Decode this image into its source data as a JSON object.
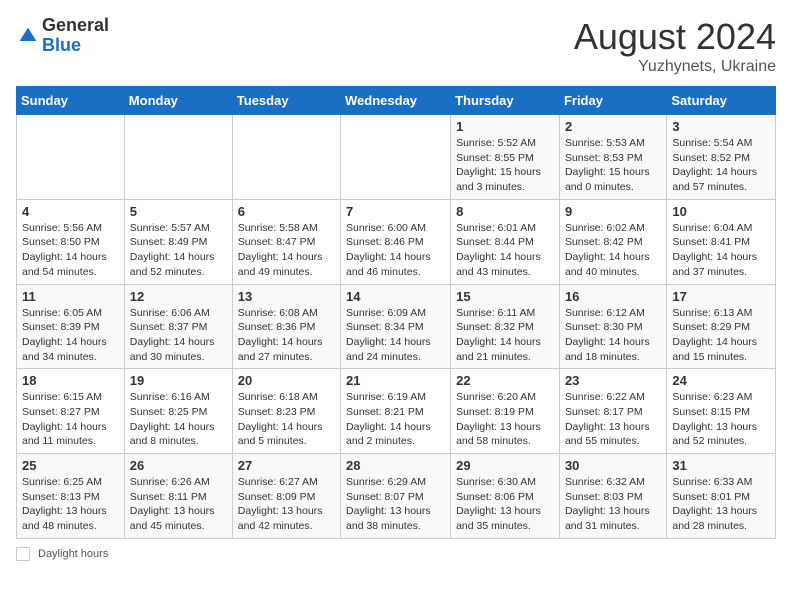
{
  "logo": {
    "general": "General",
    "blue": "Blue"
  },
  "title": "August 2024",
  "location": "Yuzhynets, Ukraine",
  "days_of_week": [
    "Sunday",
    "Monday",
    "Tuesday",
    "Wednesday",
    "Thursday",
    "Friday",
    "Saturday"
  ],
  "footer_label": "Daylight hours",
  "weeks": [
    [
      {
        "day": "",
        "info": ""
      },
      {
        "day": "",
        "info": ""
      },
      {
        "day": "",
        "info": ""
      },
      {
        "day": "",
        "info": ""
      },
      {
        "day": "1",
        "info": "Sunrise: 5:52 AM\nSunset: 8:55 PM\nDaylight: 15 hours\nand 3 minutes."
      },
      {
        "day": "2",
        "info": "Sunrise: 5:53 AM\nSunset: 8:53 PM\nDaylight: 15 hours\nand 0 minutes."
      },
      {
        "day": "3",
        "info": "Sunrise: 5:54 AM\nSunset: 8:52 PM\nDaylight: 14 hours\nand 57 minutes."
      }
    ],
    [
      {
        "day": "4",
        "info": "Sunrise: 5:56 AM\nSunset: 8:50 PM\nDaylight: 14 hours\nand 54 minutes."
      },
      {
        "day": "5",
        "info": "Sunrise: 5:57 AM\nSunset: 8:49 PM\nDaylight: 14 hours\nand 52 minutes."
      },
      {
        "day": "6",
        "info": "Sunrise: 5:58 AM\nSunset: 8:47 PM\nDaylight: 14 hours\nand 49 minutes."
      },
      {
        "day": "7",
        "info": "Sunrise: 6:00 AM\nSunset: 8:46 PM\nDaylight: 14 hours\nand 46 minutes."
      },
      {
        "day": "8",
        "info": "Sunrise: 6:01 AM\nSunset: 8:44 PM\nDaylight: 14 hours\nand 43 minutes."
      },
      {
        "day": "9",
        "info": "Sunrise: 6:02 AM\nSunset: 8:42 PM\nDaylight: 14 hours\nand 40 minutes."
      },
      {
        "day": "10",
        "info": "Sunrise: 6:04 AM\nSunset: 8:41 PM\nDaylight: 14 hours\nand 37 minutes."
      }
    ],
    [
      {
        "day": "11",
        "info": "Sunrise: 6:05 AM\nSunset: 8:39 PM\nDaylight: 14 hours\nand 34 minutes."
      },
      {
        "day": "12",
        "info": "Sunrise: 6:06 AM\nSunset: 8:37 PM\nDaylight: 14 hours\nand 30 minutes."
      },
      {
        "day": "13",
        "info": "Sunrise: 6:08 AM\nSunset: 8:36 PM\nDaylight: 14 hours\nand 27 minutes."
      },
      {
        "day": "14",
        "info": "Sunrise: 6:09 AM\nSunset: 8:34 PM\nDaylight: 14 hours\nand 24 minutes."
      },
      {
        "day": "15",
        "info": "Sunrise: 6:11 AM\nSunset: 8:32 PM\nDaylight: 14 hours\nand 21 minutes."
      },
      {
        "day": "16",
        "info": "Sunrise: 6:12 AM\nSunset: 8:30 PM\nDaylight: 14 hours\nand 18 minutes."
      },
      {
        "day": "17",
        "info": "Sunrise: 6:13 AM\nSunset: 8:29 PM\nDaylight: 14 hours\nand 15 minutes."
      }
    ],
    [
      {
        "day": "18",
        "info": "Sunrise: 6:15 AM\nSunset: 8:27 PM\nDaylight: 14 hours\nand 11 minutes."
      },
      {
        "day": "19",
        "info": "Sunrise: 6:16 AM\nSunset: 8:25 PM\nDaylight: 14 hours\nand 8 minutes."
      },
      {
        "day": "20",
        "info": "Sunrise: 6:18 AM\nSunset: 8:23 PM\nDaylight: 14 hours\nand 5 minutes."
      },
      {
        "day": "21",
        "info": "Sunrise: 6:19 AM\nSunset: 8:21 PM\nDaylight: 14 hours\nand 2 minutes."
      },
      {
        "day": "22",
        "info": "Sunrise: 6:20 AM\nSunset: 8:19 PM\nDaylight: 13 hours\nand 58 minutes."
      },
      {
        "day": "23",
        "info": "Sunrise: 6:22 AM\nSunset: 8:17 PM\nDaylight: 13 hours\nand 55 minutes."
      },
      {
        "day": "24",
        "info": "Sunrise: 6:23 AM\nSunset: 8:15 PM\nDaylight: 13 hours\nand 52 minutes."
      }
    ],
    [
      {
        "day": "25",
        "info": "Sunrise: 6:25 AM\nSunset: 8:13 PM\nDaylight: 13 hours\nand 48 minutes."
      },
      {
        "day": "26",
        "info": "Sunrise: 6:26 AM\nSunset: 8:11 PM\nDaylight: 13 hours\nand 45 minutes."
      },
      {
        "day": "27",
        "info": "Sunrise: 6:27 AM\nSunset: 8:09 PM\nDaylight: 13 hours\nand 42 minutes."
      },
      {
        "day": "28",
        "info": "Sunrise: 6:29 AM\nSunset: 8:07 PM\nDaylight: 13 hours\nand 38 minutes."
      },
      {
        "day": "29",
        "info": "Sunrise: 6:30 AM\nSunset: 8:06 PM\nDaylight: 13 hours\nand 35 minutes."
      },
      {
        "day": "30",
        "info": "Sunrise: 6:32 AM\nSunset: 8:03 PM\nDaylight: 13 hours\nand 31 minutes."
      },
      {
        "day": "31",
        "info": "Sunrise: 6:33 AM\nSunset: 8:01 PM\nDaylight: 13 hours\nand 28 minutes."
      }
    ]
  ]
}
